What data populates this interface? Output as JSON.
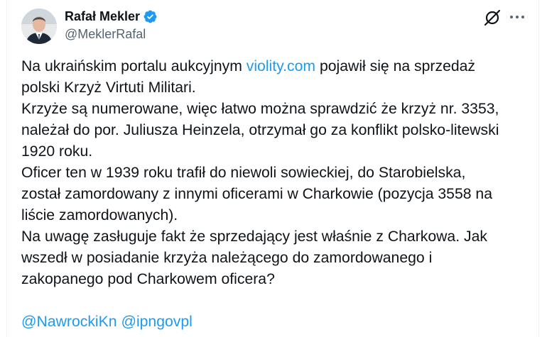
{
  "author": {
    "name": "Rafał Mekler",
    "handle": "@MeklerRafal",
    "verified": true
  },
  "icons": {
    "verified": "verified-badge-icon",
    "grok": "grok-icon",
    "more": "more-options-icon"
  },
  "colors": {
    "link": "#1d9bf0",
    "text": "#0f1419",
    "secondary": "#536471",
    "verified": "#1d9bf0"
  },
  "tweet": {
    "line1_before_link": "Na ukraińskim portalu aukcyjnym ",
    "link_text": "violity.com",
    "line1_after_link": " pojawił się na sprzedaż",
    "line2": "polski Krzyż Virtuti Militari.",
    "line3": "Krzyże są numerowane, więc łatwo można sprawdzić  że krzyż nr. 3353,",
    "line4": "należał do por. Juliusza Heinzela, otrzymał go za konflikt polsko-litewski",
    "line5": "1920 roku.",
    "line6": "Oficer ten w 1939 roku trafił do niewoli sowieckiej, do Starobielska,",
    "line7": "został zamordowany z innymi oficerami w Charkowie (pozycja 3558 na",
    "line8": "liście zamordowanych).",
    "line9": "Na uwagę zasługuje fakt że sprzedający jest właśnie z Charkowa. Jak",
    "line10": "wszedł w posiadanie krzyża należącego do zamordowanego i",
    "line11": "zakopanego pod Charkowem oficera?",
    "mention1": "@NawrockiKn",
    "mention2": "@ipngovpl"
  }
}
